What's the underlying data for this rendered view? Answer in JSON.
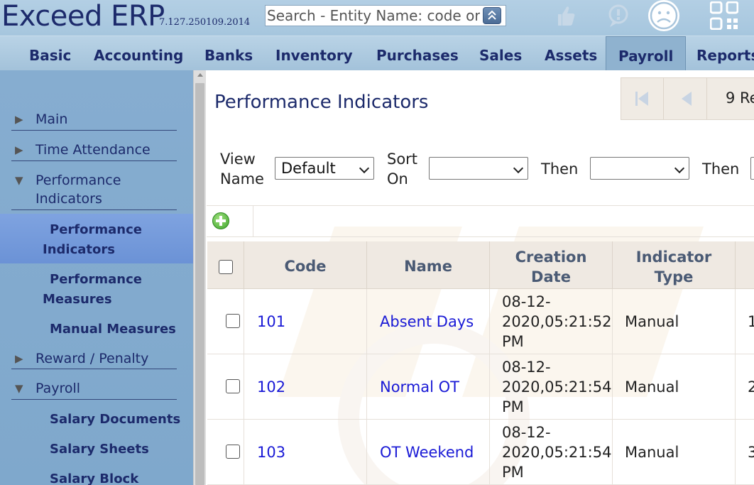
{
  "header": {
    "app_title": "Exceed ERP",
    "version": "7.127.250109.2014",
    "search_placeholder": "Search - Entity Name: code or name"
  },
  "menu": {
    "items": [
      {
        "label": "Basic"
      },
      {
        "label": "Accounting"
      },
      {
        "label": "Banks"
      },
      {
        "label": "Inventory"
      },
      {
        "label": "Purchases"
      },
      {
        "label": "Sales"
      },
      {
        "label": "Assets"
      },
      {
        "label": "Payroll"
      },
      {
        "label": "Reports"
      }
    ],
    "active": "Payroll"
  },
  "sidebar": {
    "items": [
      {
        "label": "Main",
        "expanded": false
      },
      {
        "label": "Time Attendance",
        "expanded": false
      },
      {
        "label_line1": "Performance",
        "label_line2": "Indicators",
        "expanded": true
      },
      {
        "label": "Reward / Penalty",
        "expanded": false
      },
      {
        "label": "Payroll",
        "expanded": true
      }
    ],
    "performance_children": [
      {
        "label_line1": "Performance",
        "label_line2": "Indicators",
        "active": true
      },
      {
        "label_line1": "Performance",
        "label_line2": "Measures",
        "active": false
      },
      {
        "label": "Manual Measures",
        "active": false
      }
    ],
    "payroll_children": [
      {
        "label": "Salary Documents"
      },
      {
        "label": "Salary Sheets"
      },
      {
        "label": "Salary Block"
      }
    ]
  },
  "main": {
    "title": "Performance Indicators",
    "pager": {
      "count_text": "9 Re"
    },
    "filters": {
      "view_name_line1": "View",
      "view_name_line2": "Name",
      "view_value": "Default",
      "sort_line1": "Sort",
      "sort_line2": "On",
      "then1": "Then",
      "then2": "Then"
    },
    "table": {
      "headers": {
        "code": "Code",
        "name": "Name",
        "creation_line1": "Creation",
        "creation_line2": "Date",
        "type_line1": "Indicator",
        "type_line2": "Type"
      },
      "rows": [
        {
          "code": "101",
          "name": "Absent Days",
          "date_l1": "08-12-",
          "date_l2": "2020,05:21:52",
          "date_l3": "PM",
          "type": "Manual",
          "extra": "1"
        },
        {
          "code": "102",
          "name": "Normal OT",
          "date_l1": "08-12-",
          "date_l2": "2020,05:21:54",
          "date_l3": "PM",
          "type": "Manual",
          "extra": "2"
        },
        {
          "code": "103",
          "name": "OT Weekend",
          "date_l1": "08-12-",
          "date_l2": "2020,05:21:54",
          "date_l3": "PM",
          "type": "Manual",
          "extra": "3"
        }
      ]
    }
  }
}
